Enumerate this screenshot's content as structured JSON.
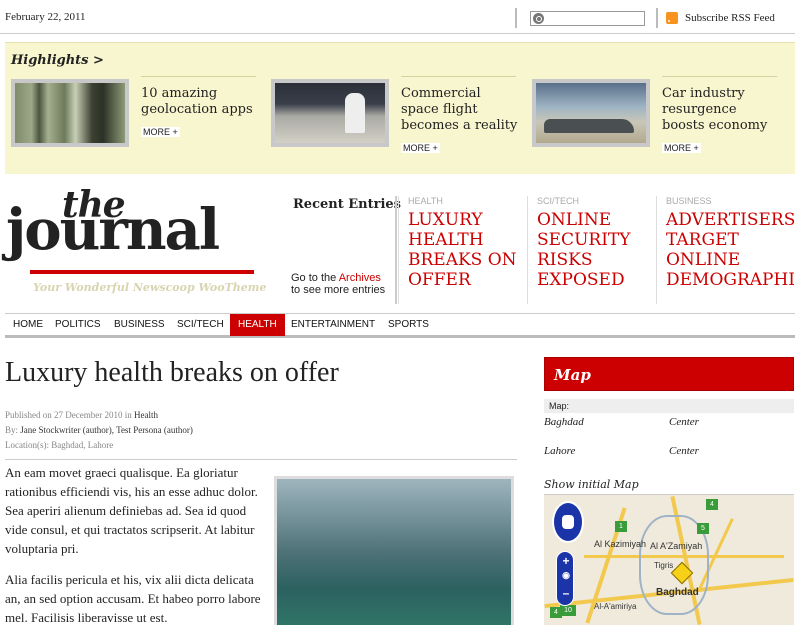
{
  "topbar": {
    "date": "February 22, 2011",
    "rss_label": "Subscribe RSS Feed"
  },
  "highlights": {
    "title": "Highlights >",
    "items": [
      {
        "text": "10 amazing geolocation apps",
        "more": "MORE +"
      },
      {
        "text": "Commercial space flight becomes a reality",
        "more": "MORE +"
      },
      {
        "text": "Car industry resurgence boosts economy",
        "more": "MORE +"
      }
    ]
  },
  "masthead": {
    "logo_top": "the",
    "logo_main": "journal",
    "tagline": "Your Wonderful Newscoop WooTheme",
    "recent_title": "Recent Entries",
    "recent_note_prefix": "Go to the ",
    "recent_note_link": "Archives",
    "recent_note_suffix": "to see more entries",
    "entries": [
      {
        "category": "HEALTH",
        "lines": [
          "LUXURY",
          "HEALTH",
          "BREAKS ON",
          "OFFER"
        ]
      },
      {
        "category": "SCI/TECH",
        "lines": [
          "ONLINE",
          "SECURITY",
          "RISKS",
          "EXPOSED"
        ]
      },
      {
        "category": "BUSINESS",
        "lines": [
          "ADVERTISERS",
          "TARGET",
          "ONLINE",
          "DEMOGRAPHIC"
        ]
      }
    ]
  },
  "nav": {
    "items": [
      "HOME",
      "POLITICS",
      "BUSINESS",
      "SCI/TECH",
      "HEALTH",
      "ENTERTAINMENT",
      "SPORTS"
    ],
    "active": "HEALTH"
  },
  "article": {
    "title": "Luxury health breaks on offer",
    "published_prefix": "Published on 27 December 2010 in ",
    "published_category": "Health",
    "by_prefix": "By: ",
    "authors": "Jane Stockwriter (author), Test Persona (author)",
    "locations": "Location(s): Baghdad, Lahore",
    "paragraph1": "An eam movet graeci qualisque. Ea gloriatur rationibus efficiendi vis, his an esse adhuc dolor. Sea aperiri alienum definiebas ad. Sea id quod vide consul, et qui tractatos scripserit. At labitur voluptaria pri.",
    "paragraph2": "Alia facilis pericula et his, vix alii dicta delicata an, an sed option accusam. Et habeo porro labore mel. Facilisis liberavisse ut est."
  },
  "sidebar": {
    "map_title": "Map",
    "map_label": "Map:",
    "locations": [
      {
        "name": "Baghdad",
        "type": "Center"
      },
      {
        "name": "Lahore",
        "type": "Center"
      }
    ],
    "show_initial": "Show initial Map",
    "map_places": [
      "Al Kazimiyah",
      "Al A'Zamiyah",
      "Tigris",
      "Baghdad",
      "Al-A'amiriya"
    ],
    "map_badges": [
      "1",
      "4",
      "5",
      "10",
      "4"
    ],
    "zoom_plus": "+",
    "zoom_minus": "–"
  },
  "colors": {
    "accent": "#cc0000",
    "highlight_bg": "#f7f6cf",
    "rss": "#f7931e"
  }
}
